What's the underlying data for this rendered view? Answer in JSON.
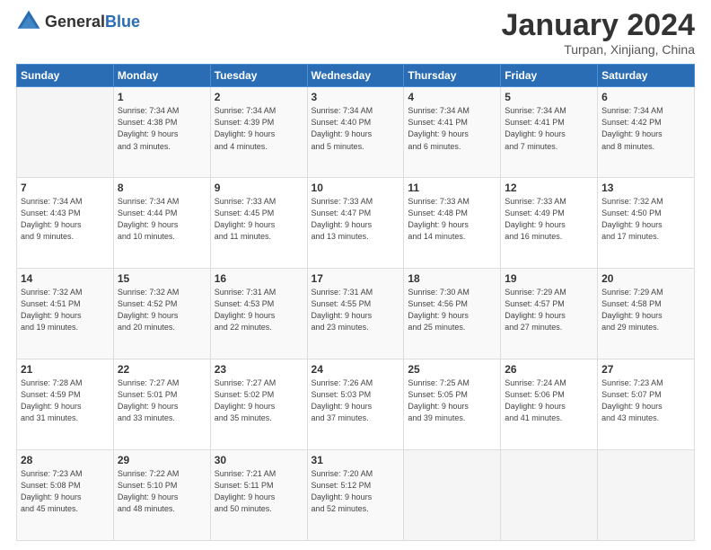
{
  "logo": {
    "general": "General",
    "blue": "Blue"
  },
  "header": {
    "title": "January 2024",
    "subtitle": "Turpan, Xinjiang, China"
  },
  "weekdays": [
    "Sunday",
    "Monday",
    "Tuesday",
    "Wednesday",
    "Thursday",
    "Friday",
    "Saturday"
  ],
  "weeks": [
    [
      {
        "day": "",
        "info": ""
      },
      {
        "day": "1",
        "info": "Sunrise: 7:34 AM\nSunset: 4:38 PM\nDaylight: 9 hours\nand 3 minutes."
      },
      {
        "day": "2",
        "info": "Sunrise: 7:34 AM\nSunset: 4:39 PM\nDaylight: 9 hours\nand 4 minutes."
      },
      {
        "day": "3",
        "info": "Sunrise: 7:34 AM\nSunset: 4:40 PM\nDaylight: 9 hours\nand 5 minutes."
      },
      {
        "day": "4",
        "info": "Sunrise: 7:34 AM\nSunset: 4:41 PM\nDaylight: 9 hours\nand 6 minutes."
      },
      {
        "day": "5",
        "info": "Sunrise: 7:34 AM\nSunset: 4:41 PM\nDaylight: 9 hours\nand 7 minutes."
      },
      {
        "day": "6",
        "info": "Sunrise: 7:34 AM\nSunset: 4:42 PM\nDaylight: 9 hours\nand 8 minutes."
      }
    ],
    [
      {
        "day": "7",
        "info": "Sunrise: 7:34 AM\nSunset: 4:43 PM\nDaylight: 9 hours\nand 9 minutes."
      },
      {
        "day": "8",
        "info": "Sunrise: 7:34 AM\nSunset: 4:44 PM\nDaylight: 9 hours\nand 10 minutes."
      },
      {
        "day": "9",
        "info": "Sunrise: 7:33 AM\nSunset: 4:45 PM\nDaylight: 9 hours\nand 11 minutes."
      },
      {
        "day": "10",
        "info": "Sunrise: 7:33 AM\nSunset: 4:47 PM\nDaylight: 9 hours\nand 13 minutes."
      },
      {
        "day": "11",
        "info": "Sunrise: 7:33 AM\nSunset: 4:48 PM\nDaylight: 9 hours\nand 14 minutes."
      },
      {
        "day": "12",
        "info": "Sunrise: 7:33 AM\nSunset: 4:49 PM\nDaylight: 9 hours\nand 16 minutes."
      },
      {
        "day": "13",
        "info": "Sunrise: 7:32 AM\nSunset: 4:50 PM\nDaylight: 9 hours\nand 17 minutes."
      }
    ],
    [
      {
        "day": "14",
        "info": "Sunrise: 7:32 AM\nSunset: 4:51 PM\nDaylight: 9 hours\nand 19 minutes."
      },
      {
        "day": "15",
        "info": "Sunrise: 7:32 AM\nSunset: 4:52 PM\nDaylight: 9 hours\nand 20 minutes."
      },
      {
        "day": "16",
        "info": "Sunrise: 7:31 AM\nSunset: 4:53 PM\nDaylight: 9 hours\nand 22 minutes."
      },
      {
        "day": "17",
        "info": "Sunrise: 7:31 AM\nSunset: 4:55 PM\nDaylight: 9 hours\nand 23 minutes."
      },
      {
        "day": "18",
        "info": "Sunrise: 7:30 AM\nSunset: 4:56 PM\nDaylight: 9 hours\nand 25 minutes."
      },
      {
        "day": "19",
        "info": "Sunrise: 7:29 AM\nSunset: 4:57 PM\nDaylight: 9 hours\nand 27 minutes."
      },
      {
        "day": "20",
        "info": "Sunrise: 7:29 AM\nSunset: 4:58 PM\nDaylight: 9 hours\nand 29 minutes."
      }
    ],
    [
      {
        "day": "21",
        "info": "Sunrise: 7:28 AM\nSunset: 4:59 PM\nDaylight: 9 hours\nand 31 minutes."
      },
      {
        "day": "22",
        "info": "Sunrise: 7:27 AM\nSunset: 5:01 PM\nDaylight: 9 hours\nand 33 minutes."
      },
      {
        "day": "23",
        "info": "Sunrise: 7:27 AM\nSunset: 5:02 PM\nDaylight: 9 hours\nand 35 minutes."
      },
      {
        "day": "24",
        "info": "Sunrise: 7:26 AM\nSunset: 5:03 PM\nDaylight: 9 hours\nand 37 minutes."
      },
      {
        "day": "25",
        "info": "Sunrise: 7:25 AM\nSunset: 5:05 PM\nDaylight: 9 hours\nand 39 minutes."
      },
      {
        "day": "26",
        "info": "Sunrise: 7:24 AM\nSunset: 5:06 PM\nDaylight: 9 hours\nand 41 minutes."
      },
      {
        "day": "27",
        "info": "Sunrise: 7:23 AM\nSunset: 5:07 PM\nDaylight: 9 hours\nand 43 minutes."
      }
    ],
    [
      {
        "day": "28",
        "info": "Sunrise: 7:23 AM\nSunset: 5:08 PM\nDaylight: 9 hours\nand 45 minutes."
      },
      {
        "day": "29",
        "info": "Sunrise: 7:22 AM\nSunset: 5:10 PM\nDaylight: 9 hours\nand 48 minutes."
      },
      {
        "day": "30",
        "info": "Sunrise: 7:21 AM\nSunset: 5:11 PM\nDaylight: 9 hours\nand 50 minutes."
      },
      {
        "day": "31",
        "info": "Sunrise: 7:20 AM\nSunset: 5:12 PM\nDaylight: 9 hours\nand 52 minutes."
      },
      {
        "day": "",
        "info": ""
      },
      {
        "day": "",
        "info": ""
      },
      {
        "day": "",
        "info": ""
      }
    ]
  ]
}
